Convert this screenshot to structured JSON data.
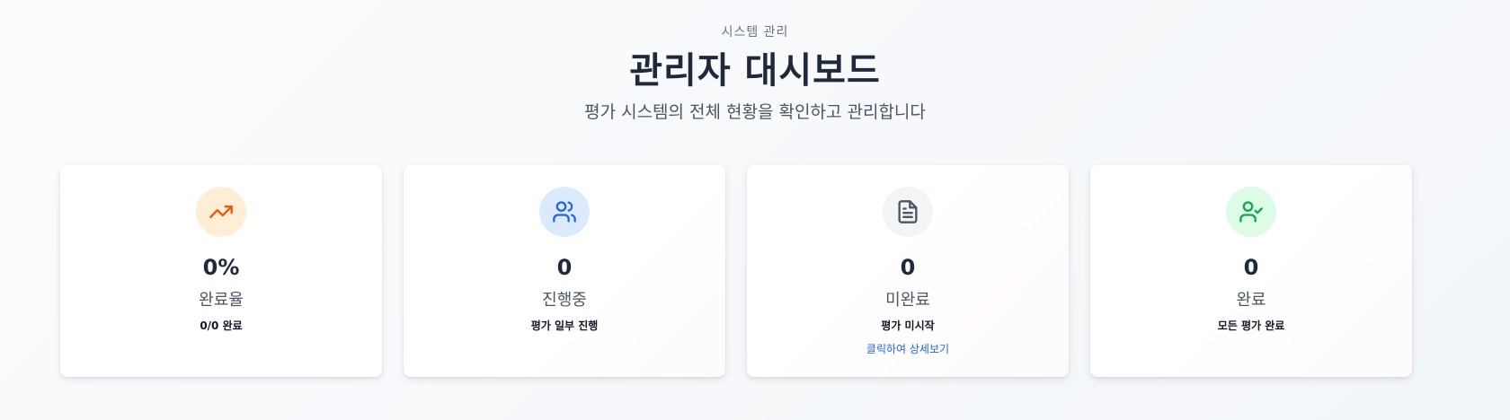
{
  "header": {
    "eyebrow": "시스템 관리",
    "title": "관리자 대시보드",
    "subtitle": "평가 시스템의 전체 현황을 확인하고 관리합니다"
  },
  "cards": [
    {
      "icon": "trending-up-icon",
      "icon_color": "#ea580c",
      "icon_bg": "#ffedd5",
      "value": "0%",
      "label": "완료율",
      "description": "0/0 완료"
    },
    {
      "icon": "users-icon",
      "icon_color": "#2563eb",
      "icon_bg": "#dbeafe",
      "value": "0",
      "label": "진행중",
      "description": "평가 일부 진행"
    },
    {
      "icon": "file-text-icon",
      "icon_color": "#4b5563",
      "icon_bg": "#f3f4f6",
      "value": "0",
      "label": "미완료",
      "description": "평가 미시작",
      "link": "클릭하여 상세보기"
    },
    {
      "icon": "user-check-icon",
      "icon_color": "#16a34a",
      "icon_bg": "#dcfce7",
      "value": "0",
      "label": "완료",
      "description": "모든 평가 완료"
    }
  ]
}
